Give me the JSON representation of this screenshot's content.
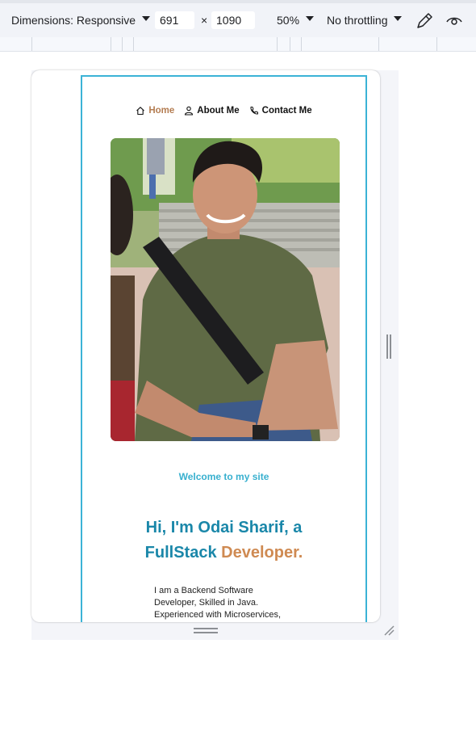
{
  "toolbar": {
    "dimensions_label": "Dimensions: Responsive",
    "width_value": "691",
    "times_symbol": "×",
    "height_value": "1090",
    "zoom_label": "50%",
    "throttle_label": "No throttling",
    "icons": [
      "eyedropper-icon",
      "eye-icon"
    ]
  },
  "site": {
    "nav": [
      {
        "label": "Home",
        "icon": "home-icon",
        "active": true
      },
      {
        "label": "About Me",
        "icon": "person-icon",
        "active": false
      },
      {
        "label": "Contact Me",
        "icon": "phone-icon",
        "active": false
      }
    ],
    "welcome": "Welcome to my site",
    "hero_line1": "Hi, I'm Odai Sharif, a",
    "hero_word": "FullStack",
    "hero_accent": "Developer.",
    "bio": [
      "I am a Backend Software",
      "Developer, Skilled in Java.",
      "Experienced with Microservices,"
    ],
    "colors": {
      "accent_brown": "#cf8a52",
      "heading_teal": "#1a87a9",
      "welcome_cyan": "#38b0cf",
      "viewport_border": "#3bb3d6"
    }
  }
}
